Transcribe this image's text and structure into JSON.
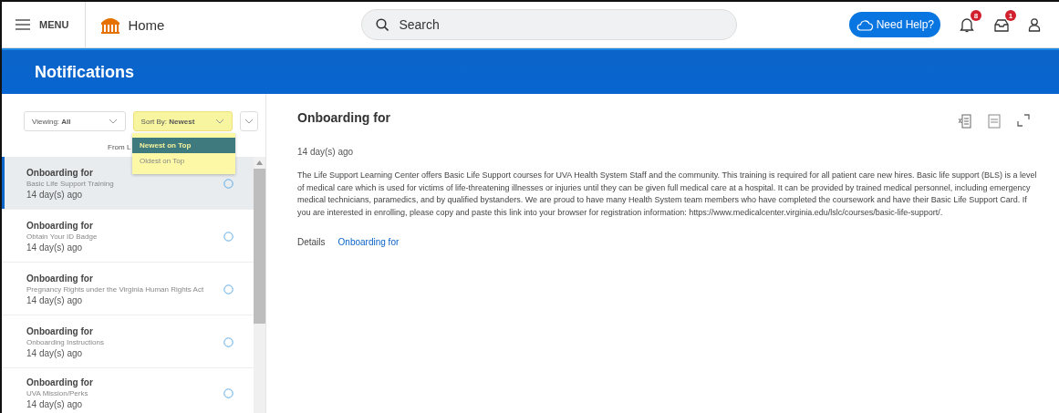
{
  "top_bar": {
    "menu_label": "MENU",
    "home_label": "Home",
    "search": {
      "placeholder": "Search"
    },
    "help_button": "Need Help?",
    "notifications_badge": "8",
    "inbox_badge": "1"
  },
  "page_title": "Notifications",
  "filters": {
    "viewing": "Viewing: **All**",
    "sort": "Sort By: **Newest**",
    "from_text": "From L"
  },
  "sort_menu": [
    {
      "label": "Newest on Top",
      "selected": true
    },
    {
      "label": "Oldest on Top",
      "selected": false
    }
  ],
  "items": [
    {
      "title": "Onboarding for",
      "subtitle": "Basic Life Support Training",
      "time": "14 day(s) ago",
      "selected": true
    },
    {
      "title": "Onboarding for",
      "subtitle": "Obtain Your ID Badge",
      "time": "14 day(s) ago",
      "selected": false
    },
    {
      "title": "Onboarding for",
      "subtitle": "Pregnancy Rights under the Virginia Human Rights Act",
      "time": "14 day(s) ago",
      "selected": false
    },
    {
      "title": "Onboarding for",
      "subtitle": "Onboarding Instructions",
      "time": "14 day(s) ago",
      "selected": false
    },
    {
      "title": "Onboarding for",
      "subtitle": "UVA Mission/Perks",
      "time": "14 day(s) ago",
      "selected": false
    }
  ],
  "detail": {
    "title": "Onboarding for",
    "time": "14 day(s) ago",
    "body": "The Life Support Learning Center offers Basic Life Support courses for UVA Health System Staff and the community.  This training is required for all patient care new hires. Basic life support (BLS) is a level of medical care which is used for victims of life-threatening illnesses or injuries until they can be given full medical care at a hospital. It can be provided by trained medical personnel, including emergency medical technicians, paramedics, and by qualified bystanders. We are proud to have many Health System team members who have completed the coursework and have their Basic Life Support Card.  If you are interested in enrolling, please copy and paste this link into your browser for registration information:  https://www.medicalcenter.virginia.edu/lslc/courses/basic-life-support/.",
    "details_label": "Details",
    "details_link": "Onboarding for"
  }
}
